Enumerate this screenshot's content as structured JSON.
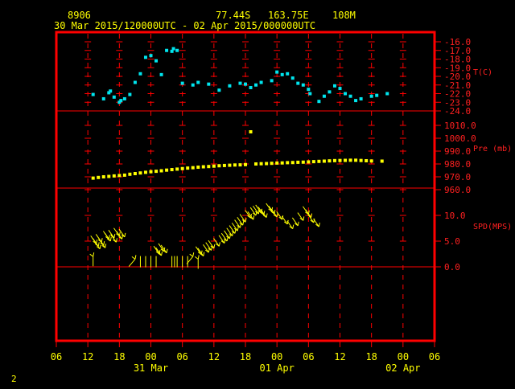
{
  "header": {
    "station": "8906",
    "lat": "77.44S",
    "lon": "163.75E",
    "elev": "108M",
    "range": "30 Mar 2015/120000UTC - 02 Apr 2015/000000UTC"
  },
  "footer": {
    "page": "2"
  },
  "colors": {
    "frame": "#ff0000",
    "temp": "#00e5ee",
    "pres": "#ffff00",
    "wind": "#ffff00",
    "label": "#ff2020",
    "text": "#ffff00"
  },
  "chart_data": {
    "type": "scatter",
    "x_axis": {
      "unit": "hours since 30 Mar 2015 06 UTC",
      "range": [
        0,
        72
      ],
      "ticks": [
        {
          "x": 0,
          "label": "06"
        },
        {
          "x": 6,
          "label": "12"
        },
        {
          "x": 12,
          "label": "18"
        },
        {
          "x": 18,
          "label": "00"
        },
        {
          "x": 24,
          "label": "06"
        },
        {
          "x": 30,
          "label": "12"
        },
        {
          "x": 36,
          "label": "18"
        },
        {
          "x": 42,
          "label": "00"
        },
        {
          "x": 48,
          "label": "06"
        },
        {
          "x": 54,
          "label": "12"
        },
        {
          "x": 60,
          "label": "18"
        },
        {
          "x": 66,
          "label": "00"
        },
        {
          "x": 72,
          "label": "06"
        }
      ],
      "dates": [
        {
          "x": 18,
          "label": "31 Mar"
        },
        {
          "x": 42,
          "label": "01 Apr"
        },
        {
          "x": 66,
          "label": "02 Apr"
        }
      ]
    },
    "panels": [
      {
        "name": "temp",
        "label": "T(C)",
        "ylim": [
          -24,
          -16
        ],
        "ticks": [
          {
            "v": -16,
            "label": "-16.0"
          },
          {
            "v": -17,
            "label": "-17.0"
          },
          {
            "v": -18,
            "label": "-18.0"
          },
          {
            "v": -19,
            "label": "-19.0"
          },
          {
            "v": -20,
            "label": "-20.0"
          },
          {
            "v": -21,
            "label": "-21.0"
          },
          {
            "v": -22,
            "label": "-22.0"
          },
          {
            "v": -23,
            "label": "-23.0"
          },
          {
            "v": -24,
            "label": "-24.0"
          }
        ],
        "points": [
          [
            7,
            -22.1
          ],
          [
            9,
            -22.6
          ],
          [
            10,
            -21.9
          ],
          [
            10.3,
            -21.7
          ],
          [
            11,
            -22.4
          ],
          [
            12,
            -23.0
          ],
          [
            12.3,
            -22.8
          ],
          [
            13,
            -22.6
          ],
          [
            14,
            -22.1
          ],
          [
            15,
            -20.7
          ],
          [
            16,
            -19.7
          ],
          [
            17,
            -17.8
          ],
          [
            18,
            -17.6
          ],
          [
            19,
            -18.2
          ],
          [
            20,
            -19.8
          ],
          [
            21,
            -17.0
          ],
          [
            22,
            -17.1
          ],
          [
            22.3,
            -16.8
          ],
          [
            23,
            -17.0
          ],
          [
            24,
            -20.8
          ],
          [
            26,
            -21.0
          ],
          [
            27,
            -20.7
          ],
          [
            29,
            -20.9
          ],
          [
            31,
            -21.6
          ],
          [
            33,
            -21.1
          ],
          [
            35,
            -20.8
          ],
          [
            36,
            -20.9
          ],
          [
            37,
            -21.3
          ],
          [
            38,
            -21.0
          ],
          [
            39,
            -20.7
          ],
          [
            41,
            -20.5
          ],
          [
            42,
            -19.5
          ],
          [
            43,
            -19.8
          ],
          [
            44,
            -19.7
          ],
          [
            45,
            -20.2
          ],
          [
            46,
            -20.8
          ],
          [
            47,
            -21.0
          ],
          [
            48,
            -21.5
          ],
          [
            48.3,
            -22.0
          ],
          [
            50,
            -22.9
          ],
          [
            51,
            -22.3
          ],
          [
            52,
            -21.8
          ],
          [
            53,
            -21.1
          ],
          [
            54,
            -21.4
          ],
          [
            55,
            -22.0
          ],
          [
            56,
            -22.3
          ],
          [
            57,
            -22.8
          ],
          [
            58,
            -22.6
          ],
          [
            60,
            -22.3
          ],
          [
            61,
            -22.2
          ],
          [
            63,
            -22.0
          ]
        ]
      },
      {
        "name": "pres",
        "label": "Pre (mb)",
        "ylim": [
          960,
          1010
        ],
        "ticks": [
          {
            "v": 1010,
            "label": "1010.0"
          },
          {
            "v": 1000,
            "label": "1000.0"
          },
          {
            "v": 990,
            "label": "990.0"
          },
          {
            "v": 980,
            "label": "980.0"
          },
          {
            "v": 970,
            "label": "970.0"
          },
          {
            "v": 960,
            "label": "960.0"
          }
        ],
        "points": [
          [
            7,
            969
          ],
          [
            8,
            969.5
          ],
          [
            9,
            970
          ],
          [
            10,
            970.3
          ],
          [
            11,
            970.7
          ],
          [
            12,
            971
          ],
          [
            13,
            971.3
          ],
          [
            14,
            972
          ],
          [
            15,
            972.5
          ],
          [
            16,
            973
          ],
          [
            17,
            973.5
          ],
          [
            18,
            974
          ],
          [
            19,
            974.3
          ],
          [
            20,
            974.7
          ],
          [
            21,
            975.2
          ],
          [
            22,
            975.6
          ],
          [
            23,
            976
          ],
          [
            24,
            976.4
          ],
          [
            25,
            976.8
          ],
          [
            26,
            977.1
          ],
          [
            27,
            977.5
          ],
          [
            28,
            977.8
          ],
          [
            29,
            978
          ],
          [
            30,
            978.3
          ],
          [
            31,
            978.6
          ],
          [
            32,
            978.8
          ],
          [
            33,
            979
          ],
          [
            34,
            979.2
          ],
          [
            35,
            979.3
          ],
          [
            36,
            979.5
          ],
          [
            37,
            1005
          ],
          [
            38,
            980
          ],
          [
            39,
            980.2
          ],
          [
            40,
            980.3
          ],
          [
            41,
            980.5
          ],
          [
            42,
            980.7
          ],
          [
            43,
            980.8
          ],
          [
            44,
            981
          ],
          [
            45,
            981.1
          ],
          [
            46,
            981.3
          ],
          [
            47,
            981.4
          ],
          [
            48,
            981.6
          ],
          [
            49,
            981.8
          ],
          [
            50,
            982
          ],
          [
            51,
            982.2
          ],
          [
            52,
            982.4
          ],
          [
            53,
            982.6
          ],
          [
            54,
            982.7
          ],
          [
            55,
            982.8
          ],
          [
            56,
            982.9
          ],
          [
            57,
            982.9
          ],
          [
            58,
            982.7
          ],
          [
            59,
            982.5
          ],
          [
            60,
            982.3
          ],
          [
            62,
            982.2
          ]
        ]
      },
      {
        "name": "spd",
        "label": "SPD(MPS)",
        "ylim": [
          -10,
          14
        ],
        "ticks": [
          {
            "v": 10,
            "label": "10.0"
          },
          {
            "v": 5,
            "label": "5.0"
          },
          {
            "v": 0,
            "label": "0.0"
          }
        ],
        "wind": [
          [
            7,
            2.0,
            0
          ],
          [
            7.6,
            4.5,
            215
          ],
          [
            8,
            4.0,
            215
          ],
          [
            8.3,
            3.5,
            215
          ],
          [
            8.6,
            4.8,
            215
          ],
          [
            9,
            4.2,
            215
          ],
          [
            9.3,
            3.7,
            215
          ],
          [
            10,
            5.4,
            215
          ],
          [
            10.3,
            5.0,
            215
          ],
          [
            11,
            5.6,
            215
          ],
          [
            11.4,
            4.8,
            215
          ],
          [
            12,
            6.0,
            215
          ],
          [
            12.5,
            5.4,
            215
          ],
          [
            13,
            5.8,
            215
          ],
          [
            15,
            1.5,
            320
          ],
          [
            16,
            1.0,
            180
          ],
          [
            17,
            1.0,
            180
          ],
          [
            18,
            1.0,
            180
          ],
          [
            19,
            1.0,
            180
          ],
          [
            19.6,
            2.5,
            215
          ],
          [
            20,
            2.2,
            215
          ],
          [
            20.5,
            3.0,
            215
          ],
          [
            21,
            2.7,
            215
          ],
          [
            22,
            1.0,
            180
          ],
          [
            22.5,
            1.0,
            180
          ],
          [
            23,
            1.0,
            180
          ],
          [
            24,
            1.0,
            180
          ],
          [
            25,
            1.0,
            180
          ],
          [
            26,
            2.0,
            320
          ],
          [
            27,
            1.5,
            0
          ],
          [
            27.6,
            2.4,
            215
          ],
          [
            28,
            2.1,
            215
          ],
          [
            29,
            2.8,
            215
          ],
          [
            29.5,
            3.2,
            215
          ],
          [
            30,
            3.6,
            215
          ],
          [
            31,
            4.0,
            215
          ],
          [
            32,
            4.6,
            215
          ],
          [
            32.5,
            5.0,
            215
          ],
          [
            33,
            5.5,
            215
          ],
          [
            33.5,
            6.0,
            215
          ],
          [
            34,
            6.5,
            215
          ],
          [
            34.5,
            7.0,
            215
          ],
          [
            35,
            7.6,
            215
          ],
          [
            35.5,
            8.1,
            215
          ],
          [
            36,
            8.7,
            215
          ],
          [
            37,
            9.5,
            215
          ],
          [
            37.5,
            9.2,
            215
          ],
          [
            38,
            10.0,
            215
          ],
          [
            38.5,
            10.3,
            215
          ],
          [
            39,
            10.5,
            215
          ],
          [
            39.5,
            10.1,
            215
          ],
          [
            40,
            9.6,
            215
          ],
          [
            41,
            10.8,
            215
          ],
          [
            41.5,
            10.3,
            215
          ],
          [
            42,
            9.7,
            215
          ],
          [
            43,
            9.2,
            215
          ],
          [
            44,
            8.3,
            215
          ],
          [
            45,
            7.4,
            215
          ],
          [
            46,
            8.0,
            215
          ],
          [
            47,
            9.0,
            215
          ],
          [
            48,
            10.2,
            215
          ],
          [
            48.5,
            9.6,
            215
          ],
          [
            49,
            8.6,
            215
          ],
          [
            50,
            7.8,
            215
          ]
        ]
      }
    ]
  }
}
